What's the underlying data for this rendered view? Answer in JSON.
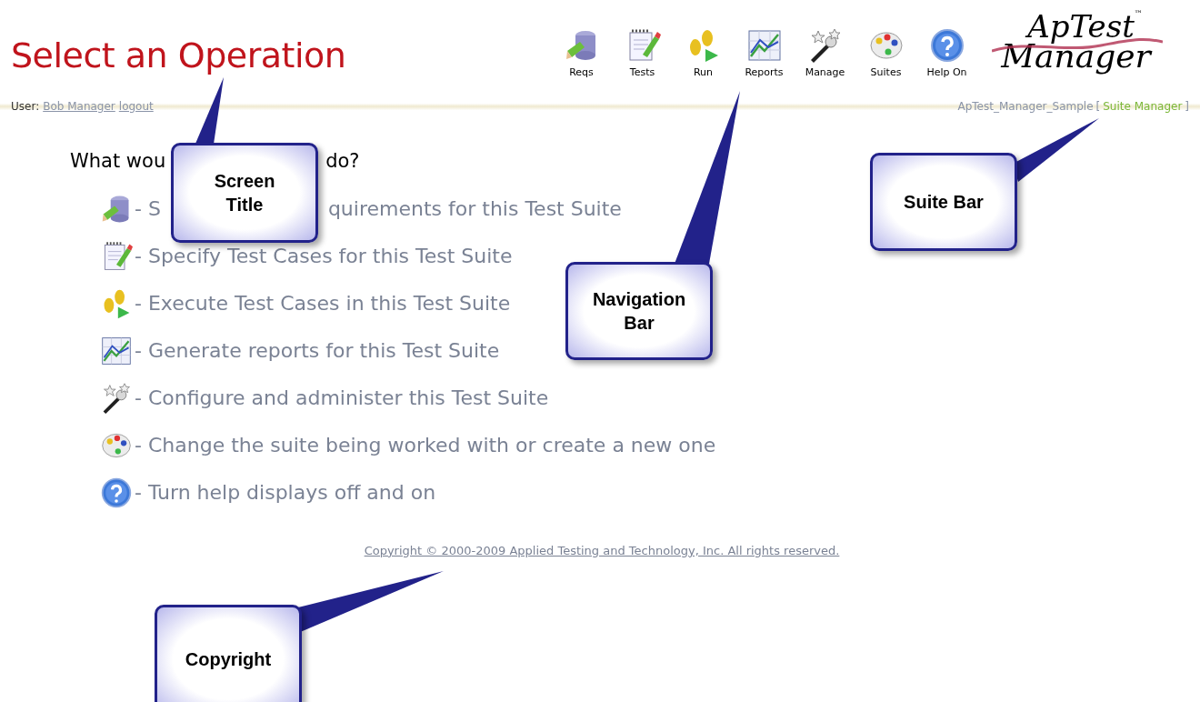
{
  "screen_title": "Select an Operation",
  "nav": [
    {
      "kind": "requirements",
      "label": "Reqs"
    },
    {
      "kind": "tests",
      "label": "Tests"
    },
    {
      "kind": "run",
      "label": "Run"
    },
    {
      "kind": "reports",
      "label": "Reports"
    },
    {
      "kind": "manage",
      "label": "Manage"
    },
    {
      "kind": "suites",
      "label": "Suites"
    },
    {
      "kind": "help",
      "label": "Help On"
    }
  ],
  "logo": {
    "line_1": "ApTest",
    "line_2": "Manager",
    "mark": "™"
  },
  "user_bar": {
    "label": "User:",
    "user": "Bob Manager",
    "logout": "logout"
  },
  "suite_bar": {
    "suite": "ApTest_Manager_Sample",
    "open_bracket": "[",
    "role": "Suite Manager",
    "close_bracket": "]"
  },
  "question": [
    "What wou",
    "do?"
  ],
  "operations": [
    {
      "kind": "requirements",
      "segments": [
        "- S",
        "quirements for this Test Suite"
      ]
    },
    {
      "kind": "tests",
      "segments": [
        "- Specify Test Cases for this Test Suite"
      ]
    },
    {
      "kind": "run",
      "segments": [
        "- Execute Test Cases in this Test Suite"
      ]
    },
    {
      "kind": "reports",
      "segments": [
        "- Generate reports for this Test Suite"
      ]
    },
    {
      "kind": "manage",
      "segments": [
        "- Configure and administer this Test Suite"
      ]
    },
    {
      "kind": "suites",
      "segments": [
        "- Change the suite being worked with or create a new one"
      ]
    },
    {
      "kind": "help",
      "segments": [
        "- Turn help displays off and on"
      ]
    }
  ],
  "copyright": "Copyright © 2000-2009 Applied Testing and Technology, Inc. All rights reserved.",
  "callouts": [
    {
      "kind": "screen-title",
      "lines": [
        "Screen",
        "Title"
      ]
    },
    {
      "kind": "navigation-bar",
      "lines": [
        "Navigation",
        "Bar"
      ]
    },
    {
      "kind": "suite-bar",
      "lines": [
        "Suite Bar"
      ]
    },
    {
      "kind": "copyright",
      "lines": [
        "Copyright"
      ]
    }
  ]
}
